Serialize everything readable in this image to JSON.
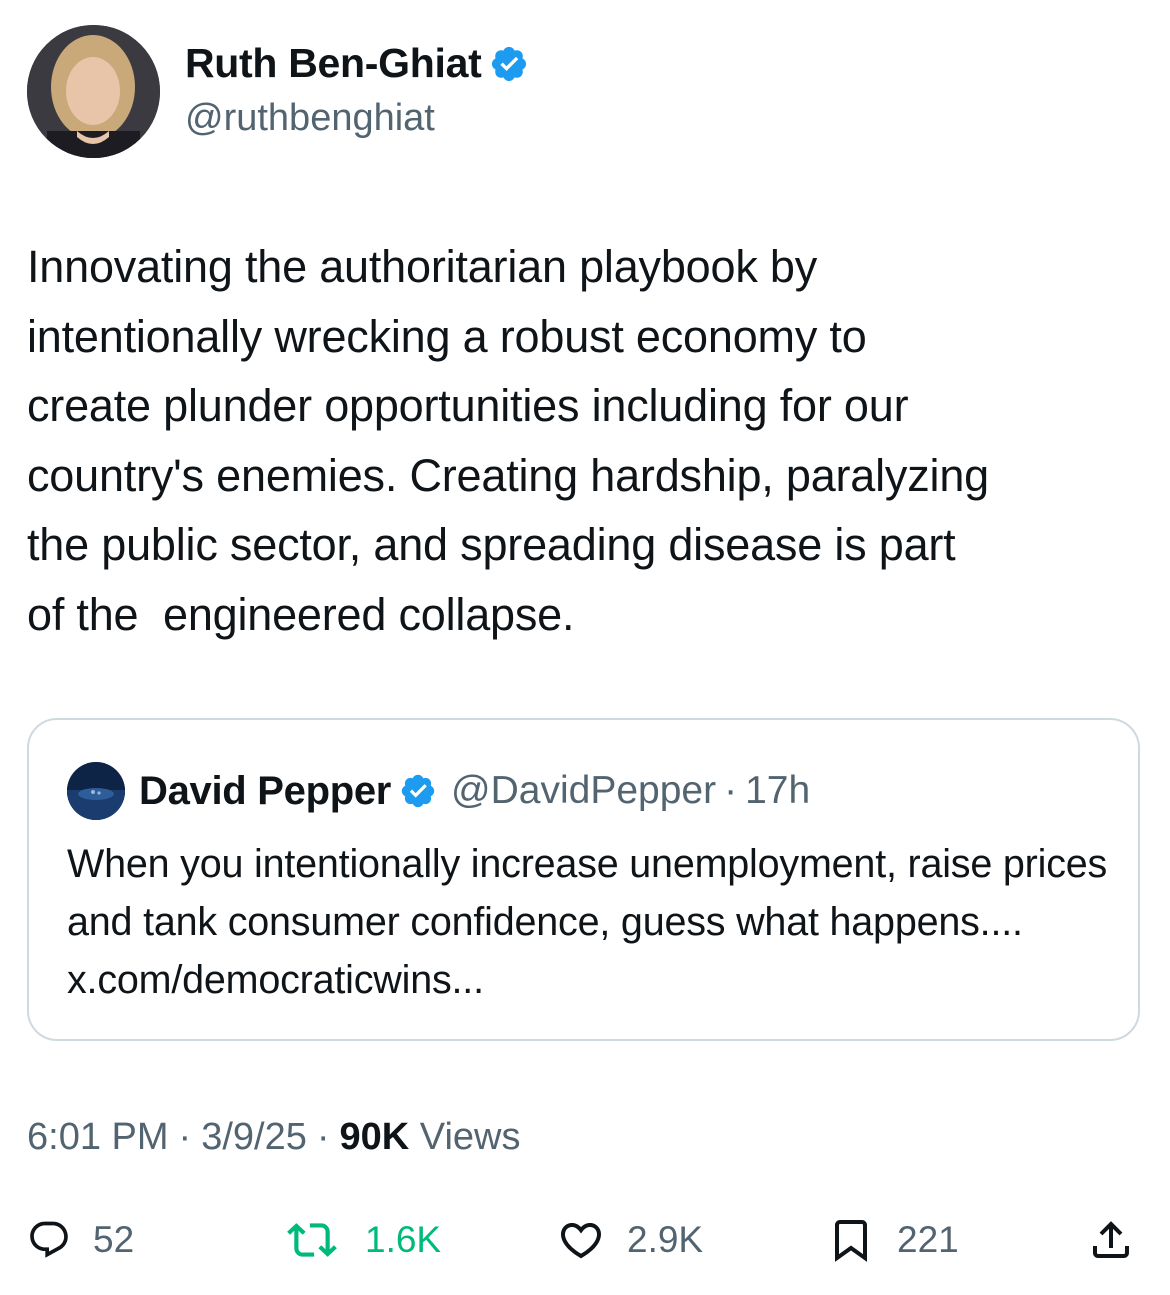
{
  "author": {
    "display_name": "Ruth Ben-Ghiat",
    "handle": "@ruthbenghiat",
    "verified": true
  },
  "tweet": {
    "text": "Innovating the authoritarian playbook by\nintentionally wrecking a robust economy to\ncreate plunder opportunities including for our\ncountry's enemies. Creating hardship, paralyzing\nthe public sector, and spreading disease is part\nof the  engineered collapse."
  },
  "quoted_tweet": {
    "display_name": "David Pepper",
    "handle": "@DavidPepper",
    "separator": "·",
    "time": "17h",
    "text": "When you intentionally increase unemployment, raise prices and tank consumer confidence, guess what happens.... x.com/democraticwins..."
  },
  "meta": {
    "time": "6:01 PM",
    "date": "3/9/25",
    "separator": "·",
    "views_count": "90K",
    "views_label": "Views"
  },
  "actions": {
    "replies": "52",
    "retweets": "1.6K",
    "likes": "2.9K",
    "bookmarks": "221"
  },
  "colors": {
    "verified_blue": "#1d9bf0",
    "retweet_green": "#00ba7c",
    "secondary_text": "#536471",
    "border": "#cfd9de"
  },
  "icons": [
    "verified-badge-icon",
    "reply-icon",
    "retweet-icon",
    "like-icon",
    "bookmark-icon",
    "share-icon"
  ]
}
